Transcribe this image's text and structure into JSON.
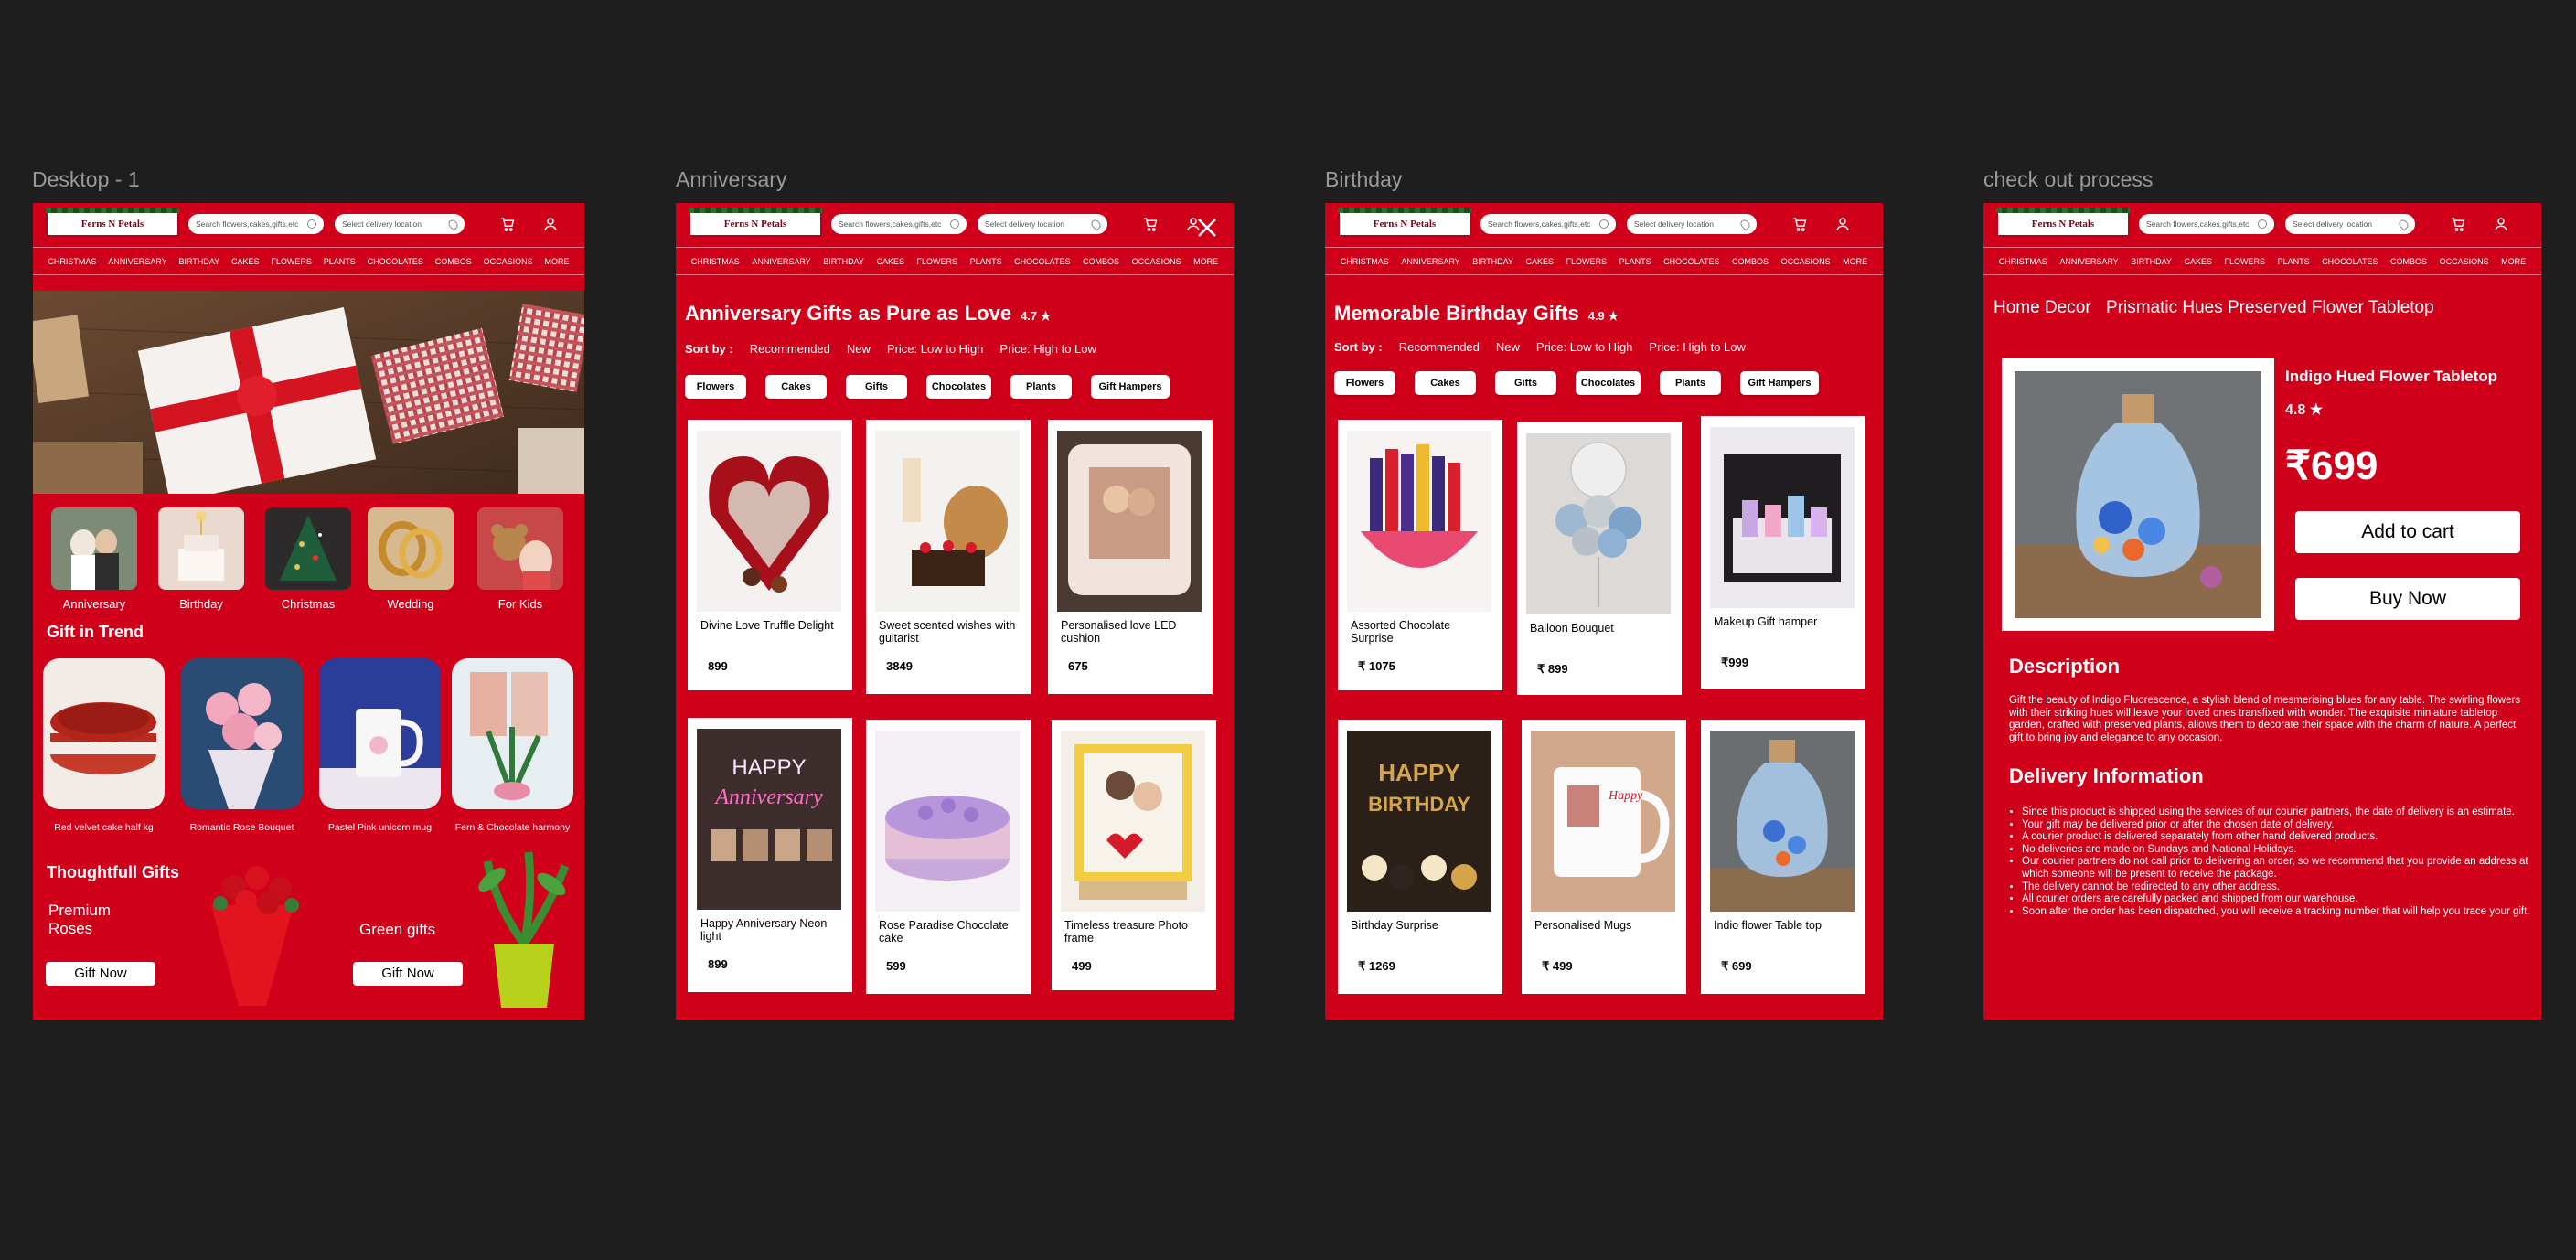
{
  "frames": {
    "desktop": {
      "label": "Desktop - 1"
    },
    "anniversary": {
      "label": "Anniversary"
    },
    "birthday": {
      "label": "Birthday"
    },
    "checkout": {
      "label": "check out process"
    }
  },
  "header": {
    "logo": "Ferns N Petals",
    "search_placeholder": "Search flowers,cakes,gifts,etc",
    "location_placeholder": "Select delivery location",
    "cart_icon": "cart-icon",
    "user_icon": "user-icon"
  },
  "nav": [
    "CHRISTMAS",
    "ANNIVERSARY",
    "BIRTHDAY",
    "CAKES",
    "FLOWERS",
    "PLANTS",
    "CHOCOLATES",
    "COMBOS",
    "OCCASIONS",
    "MORE"
  ],
  "desktop": {
    "categories": [
      "Anniversary",
      "Birthday",
      "Christmas",
      "Wedding",
      "For Kids"
    ],
    "trend_title": "Gift in Trend",
    "trend_items": [
      "Red velvet cake half kg",
      "Romantic Rose Bouquet",
      "Pastel Pink unicorn mug",
      "Fern & Chocolate harmony"
    ],
    "thoughtful_title": "Thoughtfull Gifts",
    "promo1_title": "Premium Roses",
    "promo2_title": "Green gifts",
    "gift_now": "Gift Now"
  },
  "listing": {
    "sort_label": "Sort by :",
    "sort_options": [
      "Recommended",
      "New",
      "Price: Low to High",
      "Price: High to Low"
    ],
    "filters": [
      "Flowers",
      "Cakes",
      "Gifts",
      "Chocolates",
      "Plants",
      "Gift Hampers"
    ]
  },
  "anniversary": {
    "title": "Anniversary Gifts as Pure as Love",
    "rating": "4.7 ★",
    "products": [
      {
        "name": "Divine Love Truffle Delight",
        "price": "899"
      },
      {
        "name": "Sweet scented wishes with guitarist",
        "price": "3849"
      },
      {
        "name": "Personalised love LED cushion",
        "price": "675"
      },
      {
        "name": "Happy Anniversary Neon light",
        "price": "899"
      },
      {
        "name": "Rose Paradise Chocolate cake",
        "price": "599"
      },
      {
        "name": "Timeless treasure Photo frame",
        "price": "499"
      }
    ]
  },
  "birthday": {
    "title": "Memorable Birthday Gifts",
    "rating": "4.9 ★",
    "products": [
      {
        "name": "Assorted Chocolate Surprise",
        "price": "₹ 1075"
      },
      {
        "name": "Balloon Bouquet",
        "price": "₹ 899"
      },
      {
        "name": "Makeup Gift hamper",
        "price": "₹999"
      },
      {
        "name": "Birthday Surprise",
        "price": "₹ 1269"
      },
      {
        "name": "Personalised Mugs",
        "price": "₹ 499"
      },
      {
        "name": "Indio flower Table top",
        "price": "₹ 699"
      }
    ]
  },
  "checkout": {
    "crumb1": "Home Decor",
    "crumb2": "Prismatic Hues Preserved Flower Tabletop",
    "product_name": "Indigo Hued Flower Tabletop",
    "rating": "4.8 ★",
    "price": "₹699",
    "add_to_cart": "Add to cart",
    "buy_now": "Buy Now",
    "description_title": "Description",
    "description": "Gift the beauty of Indigo Fluorescence, a stylish blend of mesmerising blues for any table. The swirling flowers with their striking hues will leave your loved ones transfixed with wonder. The exquisite miniature tabletop garden, crafted with preserved plants, allows them to decorate their space with the charm of nature. A perfect gift to bring joy and elegance to any occasion.",
    "delivery_title": "Delivery Information",
    "delivery_points": [
      "Since this product is shipped using the services of our courier partners, the date of delivery is an estimate.",
      "Your gift may be delivered prior or after the chosen date of delivery.",
      "A courier product is delivered separately from other hand delivered products.",
      "No deliveries are made on Sundays and National Holidays.",
      "Our courier partners do not call prior to delivering an order, so we recommend that you provide an address at which someone will be present to receive the package.",
      "The delivery cannot be redirected to any other address.",
      "All courier orders are carefully packed and shipped from our warehouse.",
      "Soon after the order has been dispatched, you will receive a tracking number that will help you trace your gift."
    ]
  }
}
